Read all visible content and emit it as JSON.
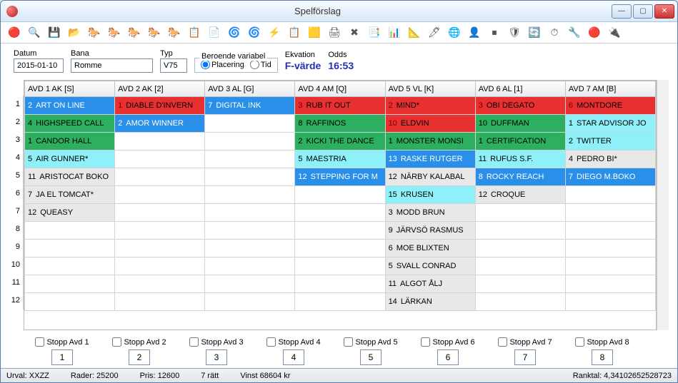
{
  "title": "Spelförslag",
  "toolbar_icons": [
    "🔴",
    "🔍",
    "💾",
    "📂",
    "🐎",
    "🐎",
    "🐎",
    "🐎",
    "🐎",
    "📋",
    "📄",
    "🌀",
    "🌀",
    "⚡",
    "📋",
    "🟨",
    "🖨",
    "✖",
    "📑",
    "📊",
    "📐",
    "🖊",
    "🌐",
    "👤",
    "⏹",
    "🛡",
    "🔄",
    "⏱",
    "🔧",
    "🔴",
    "🔌"
  ],
  "fields": {
    "datum_label": "Datum",
    "datum_value": "2015-01-10",
    "bana_label": "Bana",
    "bana_value": "Romme",
    "typ_label": "Typ",
    "typ_value": "V75",
    "beroende_label": "Beroende variabel",
    "radio_placering": "Placering",
    "radio_tid": "Tid",
    "ekvation_label": "Ekvation",
    "ekvation_value": "F-värde",
    "odds_label": "Odds",
    "odds_value": "16:53"
  },
  "headers": [
    "AVD 1 AK  [S]",
    "AVD 2 AK  [2]",
    "AVD 3 AL  [G]",
    "AVD 4 AM  [Q]",
    "AVD 5 VL  [K]",
    "AVD 6 AL  [1]",
    "AVD 7 AM  [B]"
  ],
  "row_labels": [
    "1",
    "2",
    "3",
    "4",
    "5",
    "6",
    "7",
    "8",
    "9",
    "10",
    "11",
    "12"
  ],
  "grid": [
    [
      {
        "n": "2",
        "t": "ART ON LINE",
        "c": "blue"
      },
      {
        "n": "1",
        "t": "DIABLE D'INVERN",
        "c": "red"
      },
      {
        "n": "7",
        "t": "DIGITAL INK",
        "c": "blue"
      },
      {
        "n": "3",
        "t": "RUB IT OUT",
        "c": "red"
      },
      {
        "n": "2",
        "t": "MIND*",
        "c": "red"
      },
      {
        "n": "3",
        "t": "OBI DEGATO",
        "c": "red"
      },
      {
        "n": "6",
        "t": "MONTDORE",
        "c": "red"
      }
    ],
    [
      {
        "n": "4",
        "t": "HIGHSPEED CALL",
        "c": "green"
      },
      {
        "n": "2",
        "t": "AMOR WINNER",
        "c": "blue"
      },
      null,
      {
        "n": "8",
        "t": "RAFFINOS",
        "c": "green"
      },
      {
        "n": "10",
        "t": "ELDVIN",
        "c": "red"
      },
      {
        "n": "10",
        "t": "DUFFMAN",
        "c": "green"
      },
      {
        "n": "1",
        "t": "STAR ADVISOR JO",
        "c": "cyan"
      }
    ],
    [
      {
        "n": "1",
        "t": "CANDOR HALL",
        "c": "green"
      },
      null,
      null,
      {
        "n": "2",
        "t": "KICKI THE DANCE",
        "c": "green"
      },
      {
        "n": "1",
        "t": "MONSTER MONSI",
        "c": "green"
      },
      {
        "n": "1",
        "t": "CERTIFICATION",
        "c": "green"
      },
      {
        "n": "2",
        "t": "TWITTER",
        "c": "cyan"
      }
    ],
    [
      {
        "n": "5",
        "t": "AIR GUNNER*",
        "c": "cyan"
      },
      null,
      null,
      {
        "n": "5",
        "t": "MAESTRIA",
        "c": "cyan"
      },
      {
        "n": "13",
        "t": "RASKE RUTGER",
        "c": "blue"
      },
      {
        "n": "11",
        "t": "RUFUS S.F.",
        "c": "cyan"
      },
      {
        "n": "4",
        "t": "PEDRO BI*",
        "c": "gray"
      }
    ],
    [
      {
        "n": "11",
        "t": "ARISTOCAT BOKO",
        "c": "gray"
      },
      null,
      null,
      {
        "n": "12",
        "t": "STEPPING FOR M",
        "c": "blue"
      },
      {
        "n": "12",
        "t": "NÄRBY KALABAL",
        "c": "gray"
      },
      {
        "n": "8",
        "t": "ROCKY REACH",
        "c": "blue"
      },
      {
        "n": "7",
        "t": "DIEGO M.BOKO",
        "c": "blue"
      }
    ],
    [
      {
        "n": "7",
        "t": "JA EL TOMCAT*",
        "c": "gray"
      },
      null,
      null,
      null,
      {
        "n": "15",
        "t": "KRUSEN",
        "c": "cyan"
      },
      {
        "n": "12",
        "t": "CROQUE",
        "c": "gray"
      },
      null
    ],
    [
      {
        "n": "12",
        "t": "QUEASY",
        "c": "gray"
      },
      null,
      null,
      null,
      {
        "n": "3",
        "t": "MODD BRUN",
        "c": "gray"
      },
      null,
      null
    ],
    [
      null,
      null,
      null,
      null,
      {
        "n": "9",
        "t": "JÄRVSÖ RASMUS",
        "c": "gray"
      },
      null,
      null
    ],
    [
      null,
      null,
      null,
      null,
      {
        "n": "6",
        "t": "MOE BLIXTEN",
        "c": "gray"
      },
      null,
      null
    ],
    [
      null,
      null,
      null,
      null,
      {
        "n": "5",
        "t": "SVALL CONRAD",
        "c": "gray"
      },
      null,
      null
    ],
    [
      null,
      null,
      null,
      null,
      {
        "n": "11",
        "t": "ALGOT ÅLJ",
        "c": "gray"
      },
      null,
      null
    ],
    [
      null,
      null,
      null,
      null,
      {
        "n": "14",
        "t": "LÄRKAN",
        "c": "gray"
      },
      null,
      null
    ]
  ],
  "stops": [
    {
      "label": "Stopp Avd 1",
      "btn": "1"
    },
    {
      "label": "Stopp Avd 2",
      "btn": "2"
    },
    {
      "label": "Stopp Avd 3",
      "btn": "3"
    },
    {
      "label": "Stopp Avd 4",
      "btn": "4"
    },
    {
      "label": "Stopp Avd 5",
      "btn": "5"
    },
    {
      "label": "Stopp Avd 6",
      "btn": "6"
    },
    {
      "label": "Stopp Avd 7",
      "btn": "7"
    },
    {
      "label": "Stopp Avd 8",
      "btn": "8"
    }
  ],
  "status": {
    "urval": "Urval: XXZZ",
    "rader": "Rader:  25200",
    "pris": "Pris:  12600",
    "ratt": "7 rätt",
    "vinst": "Vinst 68604 kr",
    "ranktal": "Ranktal:  4,34102652528723"
  }
}
